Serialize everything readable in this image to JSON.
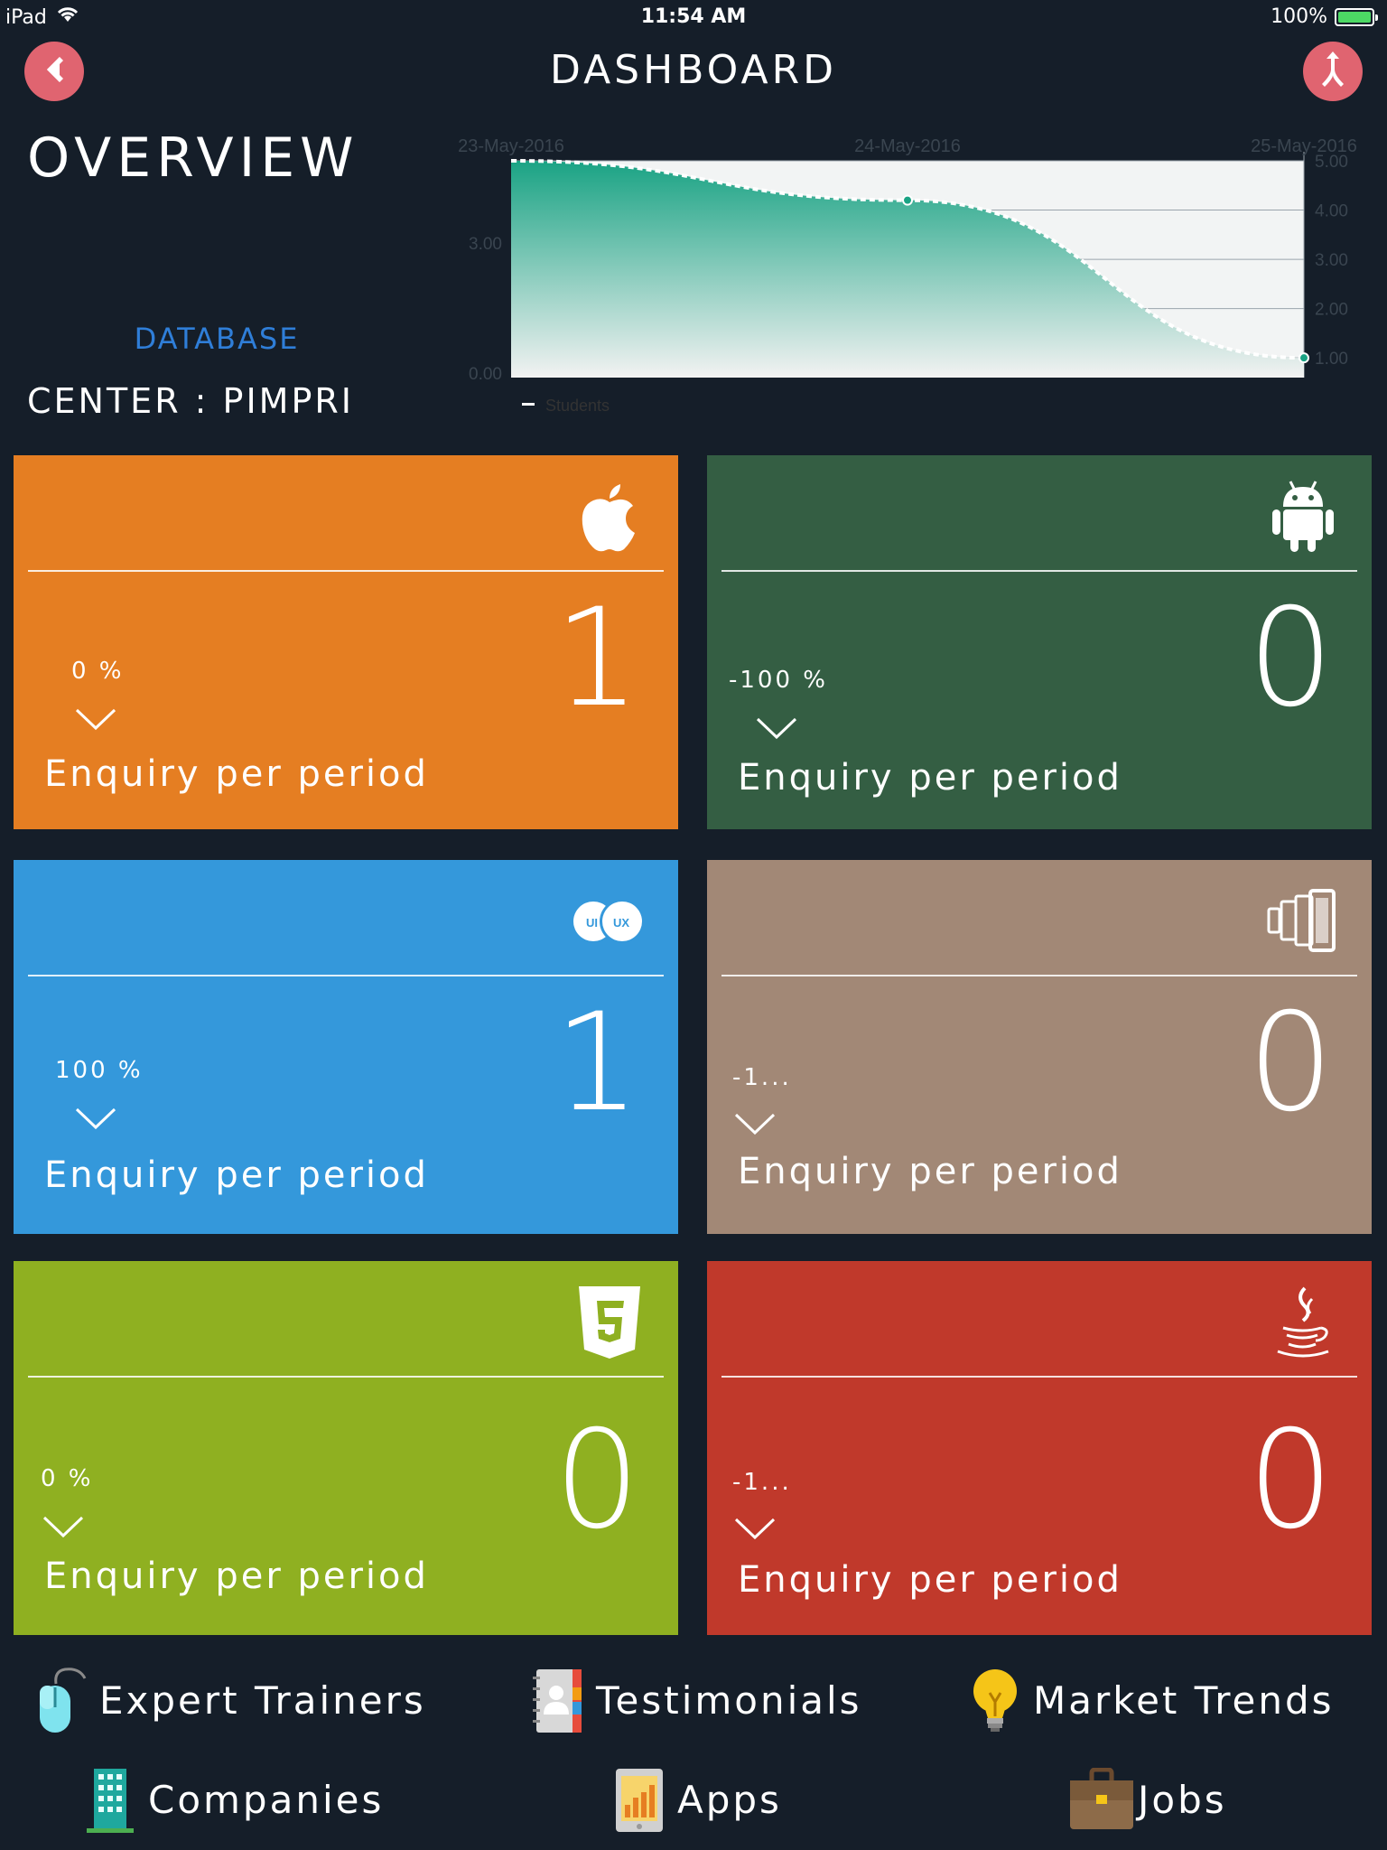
{
  "status_bar": {
    "device": "iPad",
    "time": "11:54 AM",
    "battery_text": "100%",
    "battery_level": 1.0,
    "battery_color": "#4cd964"
  },
  "header": {
    "title": "DASHBOARD",
    "back_icon": "back-chevron-icon",
    "share_icon": "merge-arrow-icon",
    "button_color": "#e06470"
  },
  "overview": {
    "title": "OVERVIEW",
    "database_link": "DATABASE",
    "center_label": "CENTER : PIMPRI"
  },
  "chart_data": {
    "type": "area",
    "x": [
      "23-May-2016",
      "24-May-2016",
      "25-May-2016"
    ],
    "series": [
      {
        "name": "Students",
        "values": [
          5.0,
          4.2,
          1.0
        ]
      }
    ],
    "left_axis_ticks": [
      "3.00",
      "0.00"
    ],
    "right_axis_ticks": [
      "5.00",
      "4.00",
      "3.00",
      "2.00",
      "1.00"
    ],
    "right_ylim": [
      0.6,
      5.0
    ],
    "grid": true,
    "legend": "bottom-left",
    "fill_color": "#1aa384"
  },
  "cards": [
    {
      "icon": "apple-icon",
      "percent": "0 %",
      "value": "1",
      "label": "Enquiry per period",
      "color": "#e57e22"
    },
    {
      "icon": "android-icon",
      "percent": "-100 %",
      "value": "0",
      "label": "Enquiry per period",
      "color": "#345e43"
    },
    {
      "icon": "ui-ux-icon",
      "percent": "100 %",
      "value": "1",
      "label": "Enquiry per period",
      "color": "#3498db"
    },
    {
      "icon": "responsive-devices-icon",
      "percent": "-1...",
      "value": "0",
      "label": "Enquiry per period",
      "color": "#a28876"
    },
    {
      "icon": "html5-icon",
      "percent": "0 %",
      "value": "0",
      "label": "Enquiry per period",
      "color": "#8fb021"
    },
    {
      "icon": "java-icon",
      "percent": "-1...",
      "value": "0",
      "label": "Enquiry per period",
      "color": "#c0392b"
    }
  ],
  "footer": {
    "expert_trainers": "Expert Trainers",
    "testimonials": "Testimonials",
    "market_trends": "Market Trends",
    "companies": "Companies",
    "apps": "Apps",
    "jobs": "Jobs"
  }
}
